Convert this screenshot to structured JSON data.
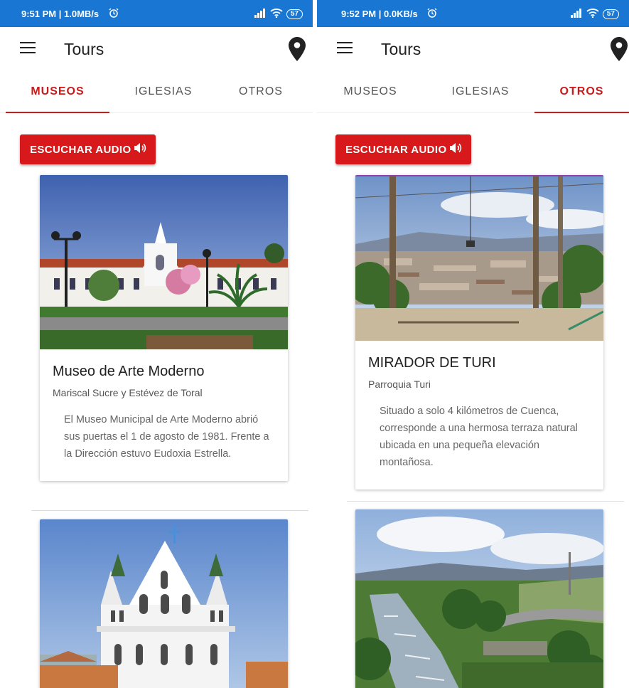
{
  "screens": [
    {
      "status": {
        "time": "9:51 PM | 1.0MB/s",
        "battery": "57"
      },
      "app_title": "Tours",
      "tabs": [
        {
          "label": "MUSEOS",
          "active": true
        },
        {
          "label": "IGLESIAS",
          "active": false
        },
        {
          "label": "OTROS",
          "active": false
        }
      ],
      "audio_button": "ESCUCHAR AUDIO",
      "card": {
        "title": "Museo de Arte Moderno",
        "address": "Mariscal Sucre y Estévez de Toral",
        "description": "El Museo Municipal de Arte Moderno abrió sus puertas el 1 de agosto de 1981. Frente a la Dirección estuvo Eudoxia Estrella."
      }
    },
    {
      "status": {
        "time": "9:52 PM | 0.0KB/s",
        "battery": "57"
      },
      "app_title": "Tours",
      "tabs": [
        {
          "label": "MUSEOS",
          "active": false
        },
        {
          "label": "IGLESIAS",
          "active": false
        },
        {
          "label": "OTROS",
          "active": true
        }
      ],
      "audio_button": "ESCUCHAR AUDIO",
      "card": {
        "title": "MIRADOR DE TURI",
        "address": "Parroquia Turi",
        "description": "Situado a solo 4 kilómetros de Cuenca, corresponde a una hermosa terraza natural ubicada en una pequeña elevación montañosa."
      }
    }
  ],
  "icons": {
    "menu": "menu-icon",
    "location": "location-pin-icon",
    "speaker": "speaker-volume-icon",
    "alarm": "alarm-icon",
    "signal": "signal-icon",
    "wifi": "wifi-icon",
    "battery": "battery-icon"
  },
  "colors": {
    "status_bar": "#1976d2",
    "accent": "#d7191c",
    "title_text": "#212121"
  }
}
